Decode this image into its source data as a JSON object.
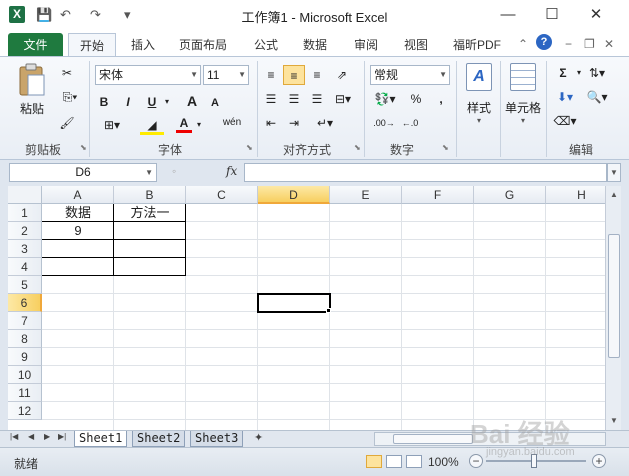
{
  "window": {
    "title": "工作簿1 - Microsoft Excel",
    "app_icon": "X",
    "minimize": "—",
    "maximize": "☐",
    "close": "✕"
  },
  "quick_access": {
    "save": "💾",
    "undo": "↶",
    "redo": "↷",
    "customize": "▾"
  },
  "tabs": [
    {
      "label": "文件"
    },
    {
      "label": "开始"
    },
    {
      "label": "插入"
    },
    {
      "label": "页面布局"
    },
    {
      "label": "公式"
    },
    {
      "label": "数据"
    },
    {
      "label": "审阅"
    },
    {
      "label": "视图"
    },
    {
      "label": "福昕PDF"
    }
  ],
  "ribbon": {
    "clipboard": {
      "label": "剪贴板",
      "paste": "粘贴"
    },
    "font": {
      "label": "字体",
      "name": "宋体",
      "size": "11",
      "bold": "B",
      "italic": "I",
      "underline": "U",
      "grow": "A",
      "shrink": "A",
      "font_color": "A",
      "phonetic": "wén"
    },
    "alignment": {
      "label": "对齐方式"
    },
    "number": {
      "label": "数字",
      "format": "常规",
      "percent": "%",
      "comma": ","
    },
    "styles": {
      "label": "样式"
    },
    "cells": {
      "label": "单元格"
    },
    "editing": {
      "label": "编辑",
      "sum": "Σ"
    }
  },
  "formula_bar": {
    "name_box": "D6",
    "fx": "fx",
    "value": ""
  },
  "grid": {
    "columns": [
      "A",
      "B",
      "C",
      "D",
      "E",
      "F",
      "G",
      "H"
    ],
    "rows": [
      "1",
      "2",
      "3",
      "4",
      "5",
      "6",
      "7",
      "8",
      "9",
      "10",
      "11",
      "12"
    ],
    "selected_column": "D",
    "selected_row": "6",
    "cells": {
      "A1": "数据",
      "B1": "方法一",
      "A2": "9"
    }
  },
  "sheets": [
    "Sheet1",
    "Sheet2",
    "Sheet3"
  ],
  "active_sheet": "Sheet1",
  "status": {
    "mode": "就绪",
    "zoom": "100%"
  },
  "watermark": {
    "text": "Bai 经验",
    "sub": "jingyan.baidu.com"
  }
}
